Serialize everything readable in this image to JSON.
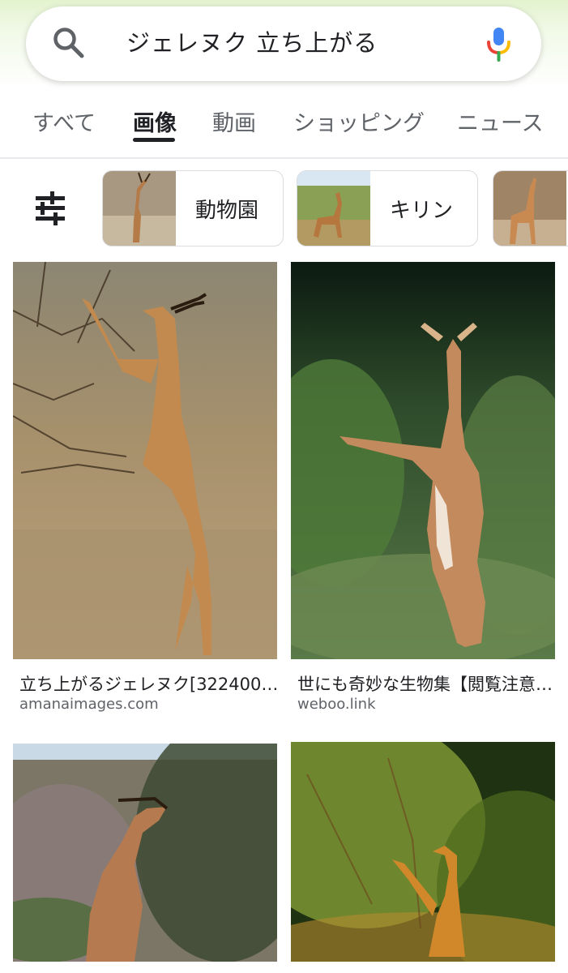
{
  "search": {
    "query": "ジェレヌク 立ち上がる"
  },
  "tabs": [
    {
      "label": "すべて",
      "active": false
    },
    {
      "label": "画像",
      "active": true
    },
    {
      "label": "動画",
      "active": false
    },
    {
      "label": "ショッピング",
      "active": false
    },
    {
      "label": "ニュース",
      "active": false
    }
  ],
  "chips": [
    {
      "label": "動物園"
    },
    {
      "label": "キリン"
    },
    {
      "label": ""
    }
  ],
  "results": [
    {
      "title": "立ち上がるジェレヌク[322400…",
      "source": "amanaimages.com"
    },
    {
      "title": "世にも奇妙な生物集【閲覧注意…",
      "source": "weboo.link"
    },
    {
      "title": "",
      "source": ""
    },
    {
      "title": "",
      "source": ""
    }
  ],
  "colors": {
    "accent_text": "#202124",
    "secondary_text": "#5f6368",
    "mic_blue": "#4285f4",
    "mic_red": "#ea4335",
    "mic_yellow": "#fbbc04",
    "mic_green": "#34a853"
  },
  "icons": [
    "search-icon",
    "mic-icon",
    "filter-icon"
  ]
}
